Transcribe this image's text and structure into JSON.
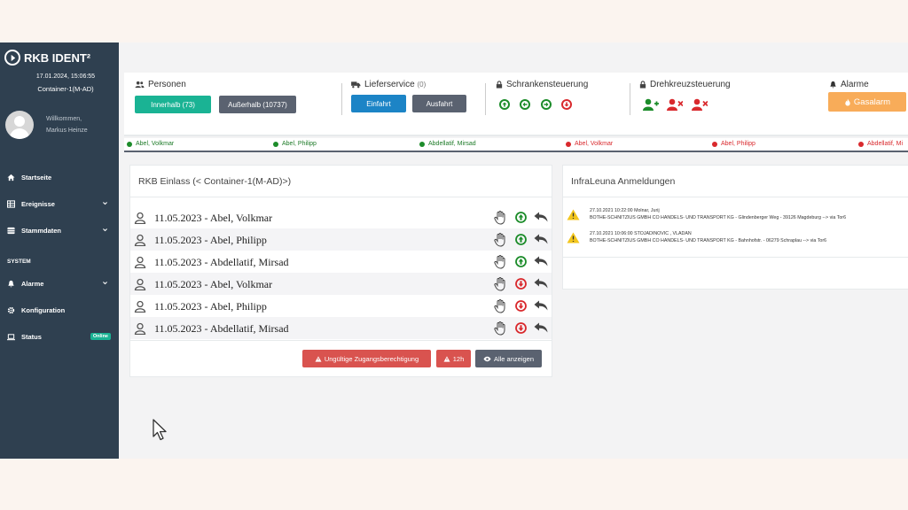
{
  "sidebar": {
    "brand": "RKB IDENT²",
    "datetime": "17.01.2024, 15:06:55",
    "container": "Container-1(M-AD)",
    "welcome": "Willkommen,",
    "username": "Markus Heinze",
    "items": [
      {
        "label": "Startseite",
        "icon": "home-icon"
      },
      {
        "label": "Ereignisse",
        "icon": "table-icon"
      },
      {
        "label": "Stammdaten",
        "icon": "database-icon"
      }
    ],
    "section_system": "SYSTEM",
    "system_items": [
      {
        "label": "Alarme",
        "icon": "bell-icon"
      },
      {
        "label": "Konfiguration",
        "icon": "gear-icon"
      },
      {
        "label": "Status",
        "icon": "laptop-icon",
        "badge": "Online"
      }
    ]
  },
  "top": {
    "personen": {
      "title": "Personen",
      "innerhalb": "Innerhalb (73)",
      "ausserhalb": "Außerhalb (10737)"
    },
    "lieferservice": {
      "title": "Lieferservice",
      "count": "(0)",
      "einfahrt": "Einfahrt",
      "ausfahrt": "Ausfahrt"
    },
    "schranken": {
      "title": "Schrankensteuerung"
    },
    "drehkreuz": {
      "title": "Drehkreuzsteuerung"
    },
    "alarme": {
      "title": "Alarme",
      "gasalarm": "Gasalarm"
    }
  },
  "ticker": [
    {
      "name": "Abel, Volkmar",
      "status": "in"
    },
    {
      "name": "Abel, Philipp",
      "status": "in"
    },
    {
      "name": "Abdellatif, Mirsad",
      "status": "in"
    },
    {
      "name": "Abel, Volkmar",
      "status": "out"
    },
    {
      "name": "Abel, Philipp",
      "status": "out"
    },
    {
      "name": "Abdellatif, Mi",
      "status": "out"
    }
  ],
  "einlass": {
    "title": "RKB Einlass (< Container-1(M-AD)>)",
    "rows": [
      {
        "text": "11.05.2023 - Abel, Volkmar",
        "dir": "in"
      },
      {
        "text": "11.05.2023 - Abel, Philipp",
        "dir": "in"
      },
      {
        "text": "11.05.2023 - Abdellatif, Mirsad",
        "dir": "in"
      },
      {
        "text": "11.05.2023 - Abel, Volkmar",
        "dir": "out"
      },
      {
        "text": "11.05.2023 - Abel, Philipp",
        "dir": "out"
      },
      {
        "text": "11.05.2023 - Abdellatif, Mirsad",
        "dir": "out"
      }
    ],
    "btn_invalid": "Ungültige Zugangsberechtigung",
    "btn_12h": "12h",
    "btn_all": "Alle anzeigen"
  },
  "infraleuna": {
    "title": "InfraLeuna Anmeldungen",
    "notes": [
      {
        "line1": "27.10.2021 10:22:00 Molnar, Jurij",
        "line2": "BOTHE-SCHNITZIUS GMBH CO HANDELS- UND TRANSPORT KG - Glindenberger Weg - 39126 Magdeburg --> via Tor6"
      },
      {
        "line1": "27.10.2021 10:06:00 STOJADINOVIC , VLADAN",
        "line2": "BOTHE-SCHNITZIUS GMBH CO HANDELS- UND TRANSPORT KG - Bahnhofstr. - 06279 Schraplau --> via Tor6"
      }
    ]
  },
  "colors": {
    "sidebar": "#2f4050",
    "teal": "#1ab394",
    "slate": "#5a6270",
    "blue": "#1c84c6",
    "red": "#d9292d",
    "green": "#1c8c2a",
    "orange": "#f8ac59"
  }
}
